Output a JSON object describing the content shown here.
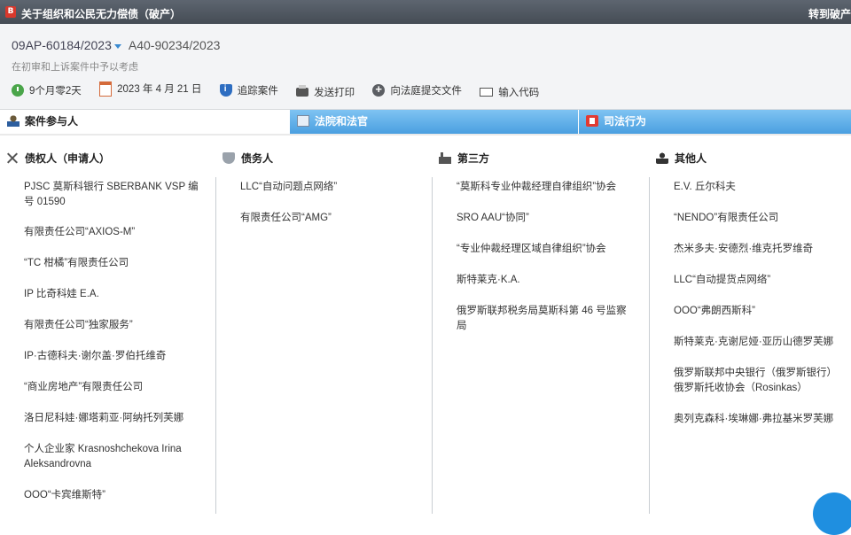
{
  "titlebar": {
    "title": "关于组织和公民无力偿债（破产）",
    "goto_label": "转到破产"
  },
  "case": {
    "number": "09AP-60184/2023",
    "related_number": "A40-90234/2023",
    "subtitle": "在初审和上诉案件中予以考虑"
  },
  "toolbar": {
    "duration": "9个月零2天",
    "date": "2023 年 4 月 21 日",
    "track": "追踪案件",
    "print": "发送打印",
    "submit": "向法庭提交文件",
    "code": "输入代码"
  },
  "tabs": [
    {
      "label": "案件参与人"
    },
    {
      "label": "法院和法官"
    },
    {
      "label": "司法行为"
    }
  ],
  "columns": [
    {
      "heading": "债权人（申请人）",
      "icon": "swords-icon",
      "items": [
        "PJSC 莫斯科银行 SBERBANK VSP 编号 01590",
        "有限责任公司“AXIOS-M”",
        "“TC 柑橘”有限责任公司",
        "IP 比奇科娃 E.A.",
        "有限责任公司“独家服务”",
        "IP·古德科夫·谢尔盖·罗伯托维奇",
        "“商业房地产”有限责任公司",
        "洛日尼科娃·娜塔莉亚·阿纳托列芙娜",
        "个人企业家 Krasnoshchekova Irina Aleksandrovna",
        "OOO“卡宾维斯特”"
      ]
    },
    {
      "heading": "债务人",
      "icon": "shield-icon",
      "items": [
        "LLC“自动问题点网络”",
        "有限责任公司“AMG”"
      ]
    },
    {
      "heading": "第三方",
      "icon": "factory-icon",
      "items": [
        "“莫斯科专业仲裁经理自律组织”协会",
        "SRO AAU“协同”",
        "“专业仲裁经理区域自律组织”协会",
        "斯特莱克·K.A.",
        "俄罗斯联邦税务局莫斯科第 46 号监察局"
      ]
    },
    {
      "heading": "其他人",
      "icon": "person-icon",
      "items": [
        "E.V. 丘尔科夫",
        "“NENDO”有限责任公司",
        "杰米多夫·安德烈·维克托罗维奇",
        "LLC“自动提货点网络”",
        "OOO“弗朗西斯科”",
        "斯特莱克·克谢尼娅·亚历山德罗芙娜",
        "俄罗斯联邦中央银行（俄罗斯银行）俄罗斯托收协会（Rosinkas）",
        "奥列克森科·埃琳娜·弗拉基米罗芙娜"
      ]
    }
  ]
}
